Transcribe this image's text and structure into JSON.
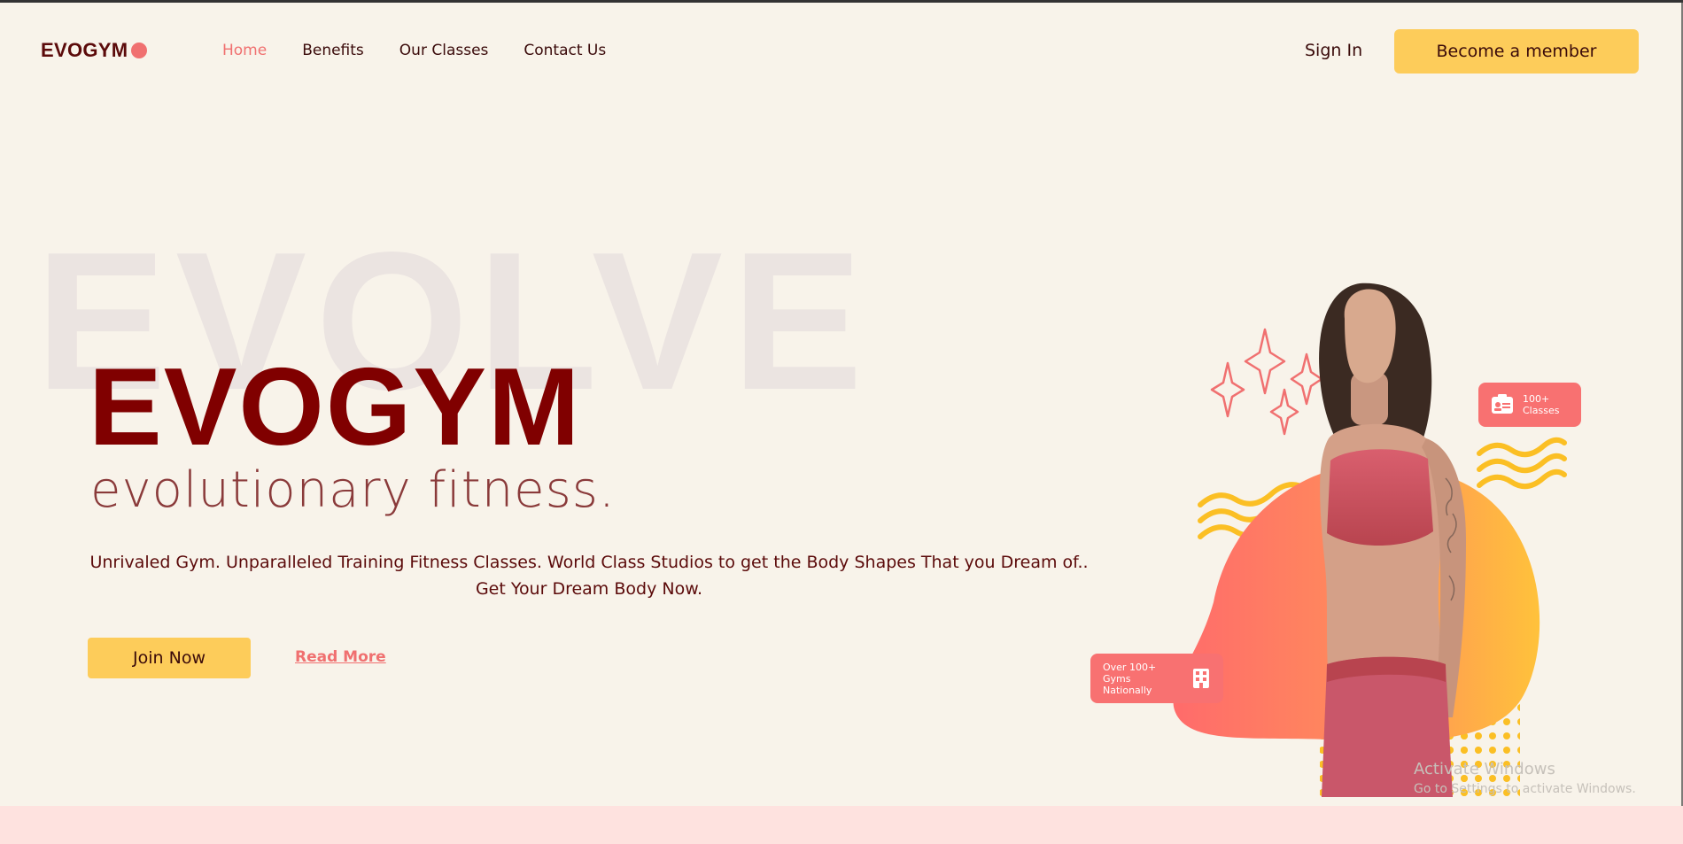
{
  "nav": {
    "logo": "EVOGYM",
    "links": [
      "Home",
      "Benefits",
      "Our Classes",
      "Contact Us"
    ],
    "active": "Home",
    "signin": "Sign In",
    "cta": "Become a member"
  },
  "hero": {
    "bg_word": "EVOLVE",
    "brand": "EVOGYM",
    "tagline": "evolutionary fitness.",
    "description": "Unrivaled Gym. Unparalleled Training Fitness Classes. World Class Studios to get the Body Shapes That you Dream of.. Get Your Dream Body Now.",
    "join": "Join Now",
    "read_more": "Read More"
  },
  "badges": {
    "classes": [
      "100+",
      "Classes"
    ],
    "gyms": [
      "Over 100+",
      "Gyms Nationally"
    ]
  },
  "watermark": {
    "title": "Activate Windows",
    "subtitle": "Go to Settings to activate Windows."
  },
  "colors": {
    "background": "#f8f3ea",
    "brand_maroon": "#800000",
    "accent_coral": "#f07070",
    "button_yellow": "#fdcc5a",
    "bottom_band": "#fee2df"
  },
  "icons": [
    "id-card-icon",
    "building-icon",
    "sparkle-icon"
  ]
}
